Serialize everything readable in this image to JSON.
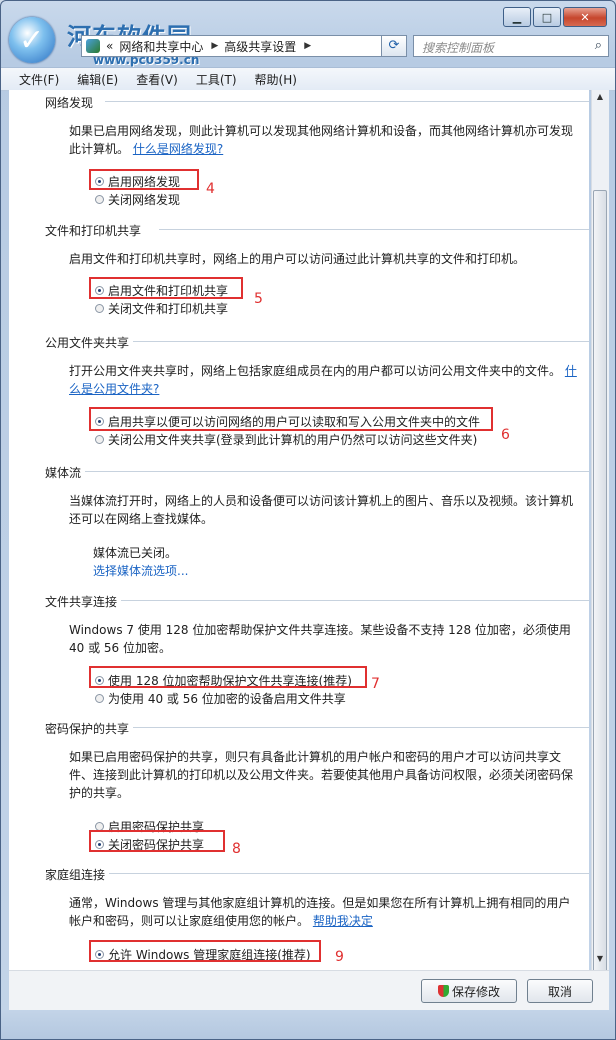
{
  "watermark": {
    "title": "河东软件园",
    "url": "www.pc0359.cn"
  },
  "address": {
    "crumbs": [
      "«",
      "网络和共享中心",
      "高级共享设置"
    ]
  },
  "search": {
    "placeholder": "搜索控制面板"
  },
  "menu": [
    "文件(F)",
    "编辑(E)",
    "查看(V)",
    "工具(T)",
    "帮助(H)"
  ],
  "sections": [
    {
      "title": "网络发现",
      "desc": "如果已启用网络发现，则此计算机可以发现其他网络计算机和设备，而其他网络计算机亦可发现此计算机。",
      "link": "什么是网络发现?",
      "options": [
        {
          "label": "启用网络发现",
          "selected": true
        },
        {
          "label": "关闭网络发现",
          "selected": false
        }
      ],
      "mark": "4"
    },
    {
      "title": "文件和打印机共享",
      "desc": "启用文件和打印机共享时，网络上的用户可以访问通过此计算机共享的文件和打印机。",
      "options": [
        {
          "label": "启用文件和打印机共享",
          "selected": true
        },
        {
          "label": "关闭文件和打印机共享",
          "selected": false
        }
      ],
      "mark": "5"
    },
    {
      "title": "公用文件夹共享",
      "desc": "打开公用文件夹共享时，网络上包括家庭组成员在内的用户都可以访问公用文件夹中的文件。",
      "link": "什么是公用文件夹?",
      "options": [
        {
          "label": "启用共享以便可以访问网络的用户可以读取和写入公用文件夹中的文件",
          "selected": true
        },
        {
          "label": "关闭公用文件夹共享(登录到此计算机的用户仍然可以访问这些文件夹)",
          "selected": false
        }
      ],
      "mark": "6"
    },
    {
      "title": "媒体流",
      "desc": "当媒体流打开时，网络上的人员和设备便可以访问该计算机上的图片、音乐以及视频。该计算机还可以在网络上查找媒体。",
      "status": "媒体流已关闭。",
      "link": "选择媒体流选项..."
    },
    {
      "title": "文件共享连接",
      "desc": "Windows 7 使用 128 位加密帮助保护文件共享连接。某些设备不支持 128 位加密，必须使用 40 或 56 位加密。",
      "options": [
        {
          "label": "使用 128 位加密帮助保护文件共享连接(推荐)",
          "selected": true
        },
        {
          "label": "为使用 40 或 56 位加密的设备启用文件共享",
          "selected": false
        }
      ],
      "mark": "7"
    },
    {
      "title": "密码保护的共享",
      "desc": "如果已启用密码保护的共享，则只有具备此计算机的用户帐户和密码的用户才可以访问共享文件、连接到此计算机的打印机以及公用文件夹。若要使其他用户具备访问权限，必须关闭密码保护的共享。",
      "options": [
        {
          "label": "启用密码保护共享",
          "selected": false
        },
        {
          "label": "关闭密码保护共享",
          "selected": true
        }
      ],
      "mark": "8"
    },
    {
      "title": "家庭组连接",
      "desc": "通常，Windows 管理与其他家庭组计算机的连接。但是如果您在所有计算机上拥有相同的用户帐户和密码，则可以让家庭组使用您的帐户。",
      "link": "帮助我决定",
      "options": [
        {
          "label": "允许 Windows 管理家庭组连接(推荐)",
          "selected": true
        }
      ],
      "mark": "9"
    }
  ],
  "buttons": {
    "save": "保存修改",
    "cancel": "取消"
  }
}
